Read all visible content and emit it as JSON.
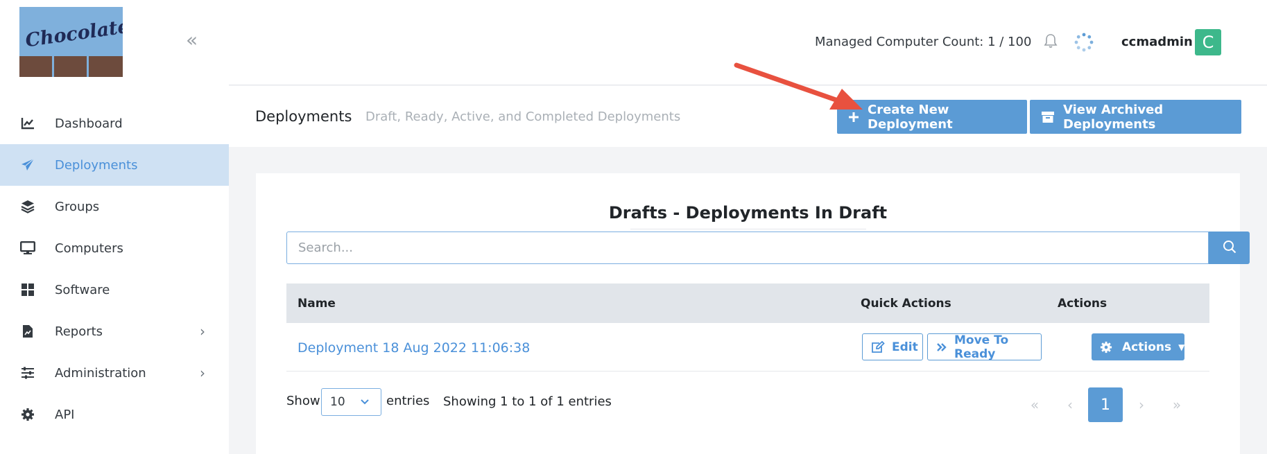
{
  "app": {
    "logo_text": "Chocolatey",
    "collapse_icon": "double-chevron-left-icon"
  },
  "sidebar": {
    "items": [
      {
        "label": "Dashboard",
        "icon": "chart-line-icon",
        "active": false,
        "has_submenu": false
      },
      {
        "label": "Deployments",
        "icon": "paper-plane-icon",
        "active": true,
        "has_submenu": false
      },
      {
        "label": "Groups",
        "icon": "layers-icon",
        "active": false,
        "has_submenu": false
      },
      {
        "label": "Computers",
        "icon": "desktop-icon",
        "active": false,
        "has_submenu": false
      },
      {
        "label": "Software",
        "icon": "grid-icon",
        "active": false,
        "has_submenu": false
      },
      {
        "label": "Reports",
        "icon": "file-chart-icon",
        "active": false,
        "has_submenu": true
      },
      {
        "label": "Administration",
        "icon": "sliders-icon",
        "active": false,
        "has_submenu": true
      },
      {
        "label": "API",
        "icon": "gear-icon",
        "active": false,
        "has_submenu": false
      }
    ]
  },
  "topbar": {
    "managed_count": "Managed Computer Count: 1 / 100",
    "username": "ccmadmin",
    "avatar_letter": "C"
  },
  "header": {
    "title": "Deployments",
    "subtitle": "Draft, Ready, Active, and Completed Deployments",
    "create_label": "Create New Deployment",
    "archive_label": "View Archived Deployments"
  },
  "card": {
    "title": "Drafts - Deployments In Draft",
    "search_placeholder": "Search...",
    "columns": [
      "Name",
      "Quick Actions",
      "Actions"
    ],
    "rows": [
      {
        "name": "Deployment 18 Aug 2022 11:06:38",
        "edit_label": "Edit",
        "move_label": "Move To Ready",
        "actions_label": "Actions"
      }
    ],
    "show_label": "Show",
    "page_size": "10",
    "entries_label": "entries",
    "info": "Showing 1 to 1 of 1 entries",
    "pagination": {
      "first": "«",
      "prev": "‹",
      "current": "1",
      "next": "›",
      "last": "»"
    }
  },
  "colors": {
    "primary": "#5b9bd5",
    "active_nav_bg": "#cfe1f3",
    "avatar": "#3db88b",
    "annotation_arrow": "#e8513f"
  }
}
